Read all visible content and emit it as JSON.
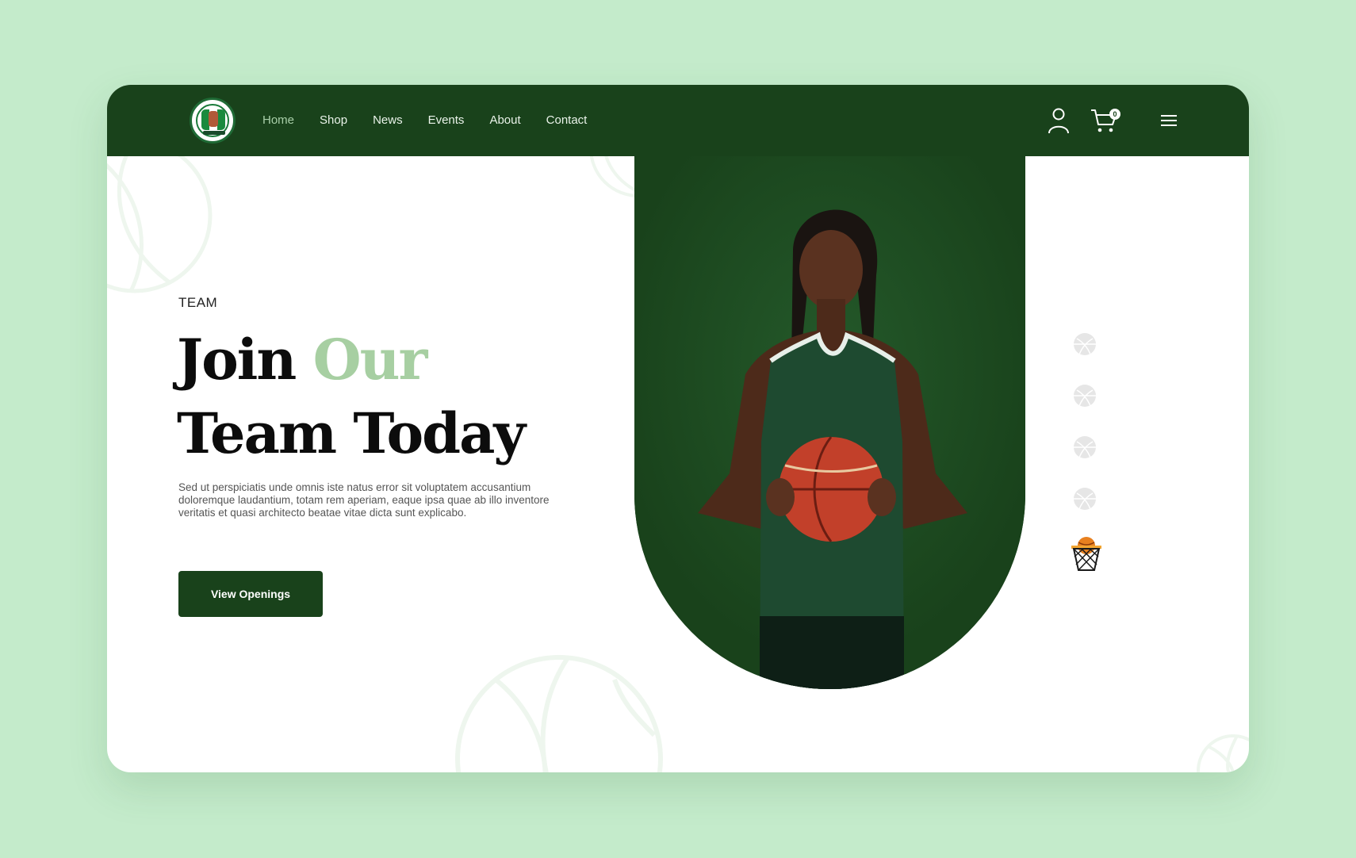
{
  "nav": {
    "links": [
      {
        "label": "Home",
        "active": true
      },
      {
        "label": "Shop",
        "active": false
      },
      {
        "label": "News",
        "active": false
      },
      {
        "label": "Events",
        "active": false
      },
      {
        "label": "About",
        "active": false
      },
      {
        "label": "Contact",
        "active": false
      }
    ],
    "cart_count": "0",
    "icons": [
      "user-icon",
      "cart-icon",
      "menu-icon"
    ]
  },
  "hero": {
    "eyebrow": "TEAM",
    "headline_word1": "Join",
    "headline_word2": "Our",
    "headline_line2": "Team Today",
    "description": "Sed ut perspiciatis unde omnis iste natus error sit voluptatem accusantium doloremque laudantium, totam rem aperiam, eaque ipsa quae ab illo inventore veritatis et quasi architecto beatae vitae dicta sunt explicabo.",
    "cta_label": "View Openings"
  },
  "slider": {
    "slide_count": 5,
    "active_index": 4
  },
  "colors": {
    "brand_dark_green": "#19421b",
    "accent_light_green": "#a7cfa2",
    "page_background": "#c4ebcb",
    "hoop_orange": "#e8801f"
  }
}
